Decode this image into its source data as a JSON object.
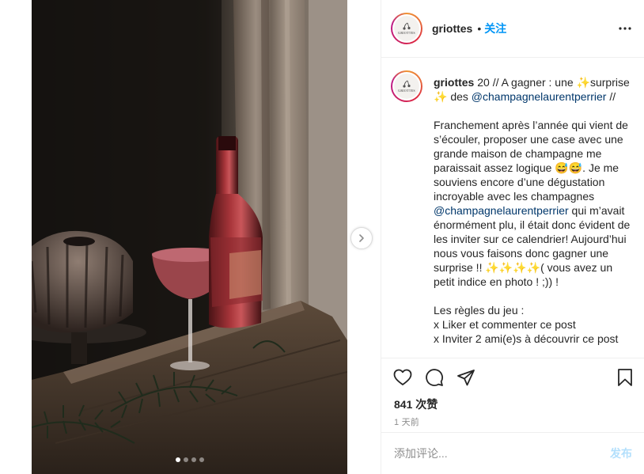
{
  "header": {
    "username": "griottes",
    "separator": "•",
    "follow_label": "关注",
    "avatar_text": "GRIOTTES"
  },
  "caption": {
    "username": "griottes",
    "text_1": " 20 // A gagner : une ✨surprise ✨ des ",
    "mention_1": "@champagnelaurentperrier",
    "text_2": " //\n\nFranchement après l’année qui vient de s’écouler, proposer une case avec une grande maison de champagne me paraissait assez logique 😅😅. Je me souviens encore d’une dégustation incroyable avec les champagnes ",
    "mention_2": "@champagnelaurentperrier",
    "text_3": " qui m’avait énormément plu, il était donc évident de les inviter sur ce calendrier! Aujourd’hui nous vous faisons donc gagner une surprise !! ✨✨✨✨( vous avez un petit indice en photo ! ;)) !\n\nLes règles du jeu :\nx Liker et commenter ce post\nx Inviter 2 ami(e)s à découvrir ce post"
  },
  "actions": {
    "likes": "841 次赞",
    "time": "1 天前",
    "comment_placeholder": "添加评论...",
    "post_label": "发布"
  },
  "carousel": {
    "slide_count": 4,
    "active_index": 0
  },
  "colors": {
    "link": "#0095f6",
    "mention": "#00376b",
    "post_disabled": "#b2dffc",
    "muted": "#8e8e8e"
  },
  "icons": [
    "more-icon",
    "heart-icon",
    "comment-icon",
    "share-icon",
    "bookmark-icon",
    "chevron-right-icon"
  ]
}
